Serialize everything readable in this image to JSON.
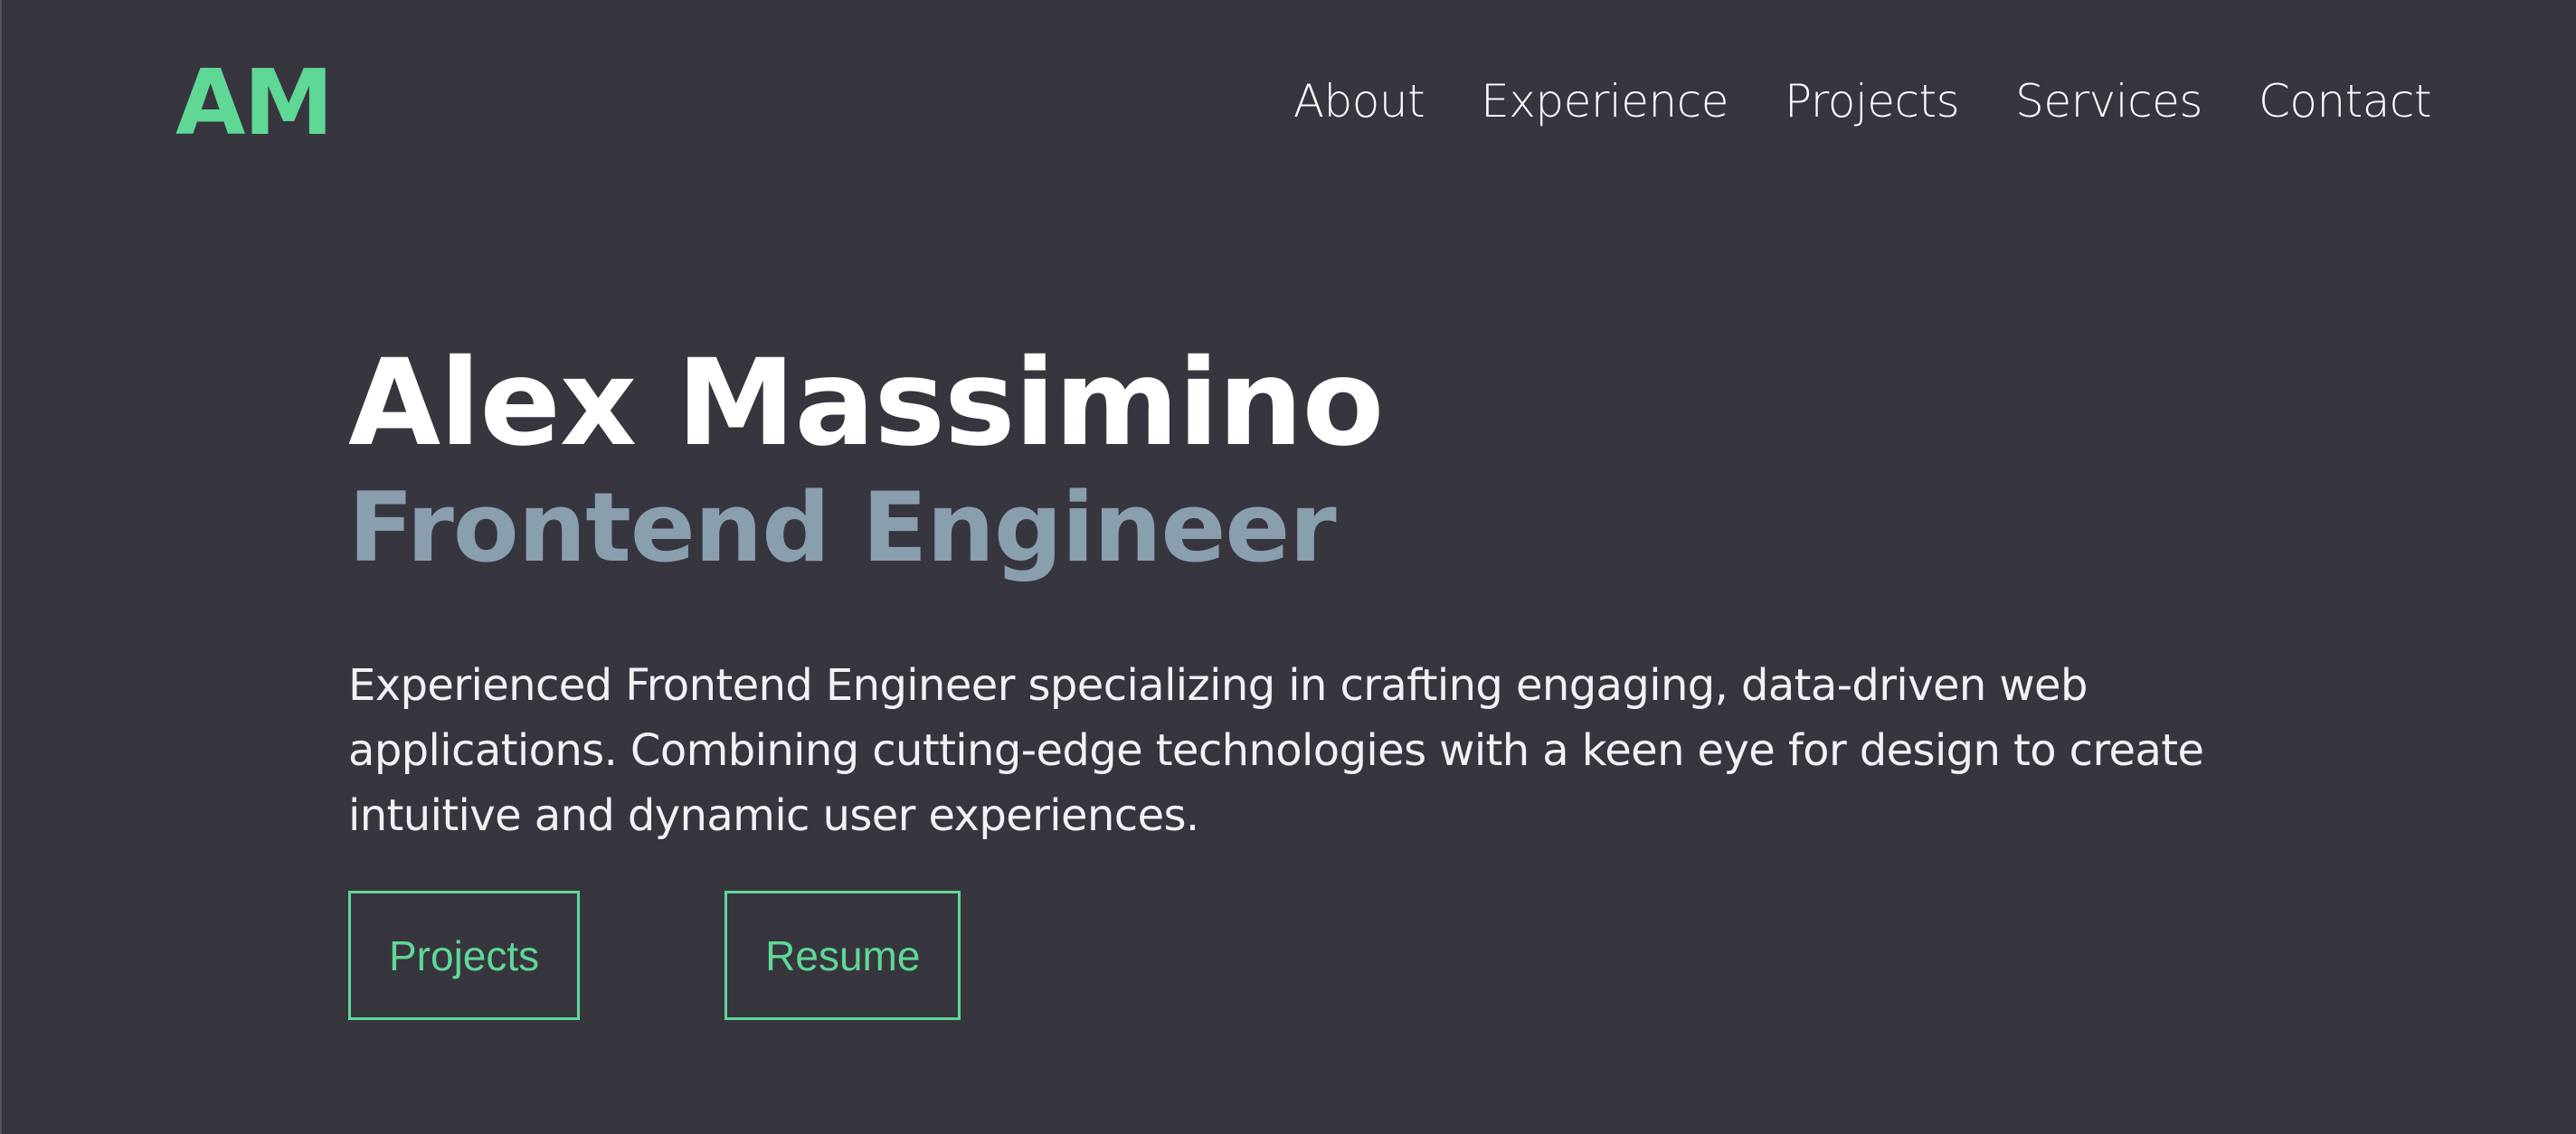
{
  "colors": {
    "background": "#37363f",
    "accent": "#5fd896",
    "subtitle": "#8a9fae",
    "text": "#ffffff"
  },
  "header": {
    "logo": "AM",
    "nav": [
      {
        "label": "About"
      },
      {
        "label": "Experience"
      },
      {
        "label": "Projects"
      },
      {
        "label": "Services"
      },
      {
        "label": "Contact"
      }
    ]
  },
  "hero": {
    "name": "Alex Massimino",
    "title": "Frontend Engineer",
    "description": "Experienced Frontend Engineer specializing in crafting engaging, data-driven web applications. Combining cutting-edge technologies with a keen eye for design to create intuitive and dynamic user experiences.",
    "buttons": [
      {
        "label": "Projects"
      },
      {
        "label": "Resume"
      }
    ]
  }
}
